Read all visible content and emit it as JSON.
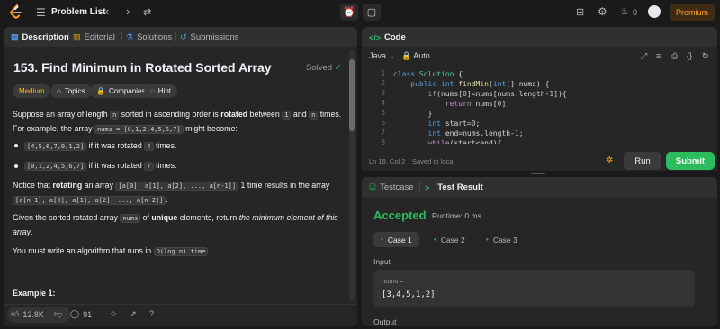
{
  "topbar": {
    "title": "Problem List",
    "streak_count": "0",
    "premium_label": "Premium"
  },
  "description_panel": {
    "tabs": [
      {
        "label": "Description"
      },
      {
        "label": "Editorial"
      },
      {
        "label": "Solutions"
      },
      {
        "label": "Submissions"
      }
    ],
    "title": "153. Find Minimum in Rotated Sorted Array",
    "status": "Solved",
    "chips": [
      "Medium",
      "Topics",
      "Companies",
      "Hint"
    ],
    "p1_a": "Suppose an array of length ",
    "p1_n": "n",
    "p1_b": " sorted in ascending order is ",
    "p1_rotated": "rotated",
    "p1_c": " between ",
    "p1_one": "1",
    "p1_d": " and ",
    "p1_n2": "n",
    "p1_e": " times.",
    "p1_f": "For example, the array ",
    "p1_nums": "nums = [0,1,2,4,5,6,7]",
    "p1_g": " might become:",
    "bullet1_code": "[4,5,6,7,0,1,2]",
    "bullet1_text": " if it was rotated ",
    "bullet1_num": "4",
    "bullet1_end": " times.",
    "bullet2_code": "[0,1,2,4,5,6,7]",
    "bullet2_text": " if it was rotated ",
    "bullet2_num": "7",
    "bullet2_end": " times.",
    "p2_a": "Notice that ",
    "p2_rotating": "rotating",
    "p2_b": " an array ",
    "p2_code1": "[a[0], a[1], a[2], ..., a[n-1]]",
    "p2_c": " 1 time results in the array",
    "p2_code2": "[a[n-1], a[0], a[1], a[2], ..., a[n-2]]",
    "p2_d": ".",
    "p3_a": "Given the sorted rotated array ",
    "p3_nums": "nums",
    "p3_b": " of ",
    "p3_unique": "unique",
    "p3_c": " elements, return ",
    "p3_italic1": "the minimum element of this",
    "p3_italic2": "array",
    "p3_d": ".",
    "p4_a": "You must write an algorithm that runs in ",
    "p4_code": "O(log n) time",
    "p4_b": ".",
    "example_label": "Example 1:",
    "likes": "12.8K",
    "comments": "91"
  },
  "code_panel": {
    "header": "Code",
    "language": "Java",
    "mode": "Auto",
    "lines": [
      {
        "n": "1"
      },
      {
        "n": "2"
      },
      {
        "n": "3"
      },
      {
        "n": "4"
      },
      {
        "n": "5"
      },
      {
        "n": "6"
      },
      {
        "n": "7"
      },
      {
        "n": "8"
      }
    ],
    "cursor_position": "Ln 19, Col 2",
    "save_status": "Saved to local",
    "run_label": "Run",
    "submit_label": "Submit"
  },
  "result_panel": {
    "tabs": [
      {
        "label": "Testcase"
      },
      {
        "label": "Test Result"
      }
    ],
    "verdict": "Accepted",
    "runtime": "Runtime: 0 ms",
    "cases": [
      "Case 1",
      "Case 2",
      "Case 3"
    ],
    "input_label": "Input",
    "var_name": "nums =",
    "var_value": "[3,4,5,1,2]",
    "output_label": "Output"
  },
  "colors": {
    "accent_green": "#2cbb5d",
    "medium_yellow": "#ffb800",
    "premium_orange": "#ffa116",
    "background": "#1a1a1a",
    "panel": "#262626"
  }
}
